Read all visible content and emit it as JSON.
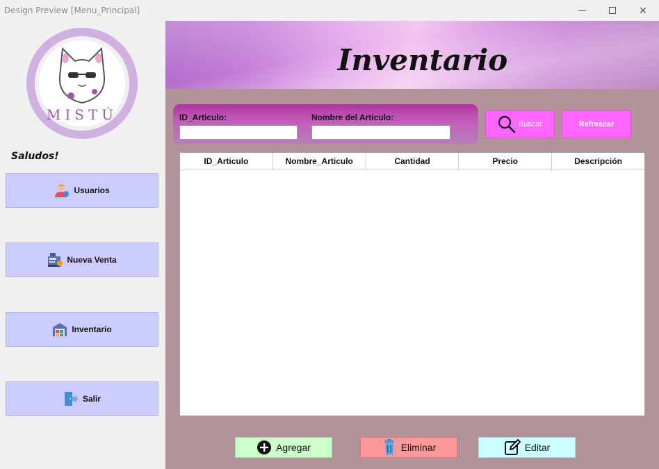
{
  "window": {
    "title": "Design Preview [Menu_Principal]",
    "minimize_icon": "minimize-icon",
    "maximize_icon": "maximize-icon",
    "close_icon": "close-icon",
    "close_glyph": "✕"
  },
  "sidebar": {
    "logo_text": "MISTÚ",
    "greeting": "Saludos!",
    "items": [
      {
        "label": "Usuarios",
        "icon": "user-icon"
      },
      {
        "label": "Nueva Venta",
        "icon": "cash-register-icon"
      },
      {
        "label": "Inventario",
        "icon": "warehouse-icon"
      },
      {
        "label": "Salir",
        "icon": "exit-door-icon"
      }
    ]
  },
  "header": {
    "title": "Inventario"
  },
  "search": {
    "id_label": "ID_Articulo:",
    "id_value": "",
    "name_label": "Nombre del Articulo:",
    "name_value": "",
    "buscar_label": "Buscar",
    "refrescar_label": "Refrescar"
  },
  "table": {
    "columns": [
      "ID_Articulo",
      "Nombre_Articulo",
      "Cantidad",
      "Precio",
      "Descripción"
    ],
    "rows": []
  },
  "actions": {
    "agregar_label": "Agregar",
    "eliminar_label": "Eliminar",
    "editar_label": "Editar"
  },
  "colors": {
    "sidebar_button": "#ccccff",
    "main_background": "#b4929a",
    "search_button": "#ff66ff",
    "agregar": "#ccffcc",
    "eliminar": "#ff9999",
    "editar": "#ccffff"
  }
}
